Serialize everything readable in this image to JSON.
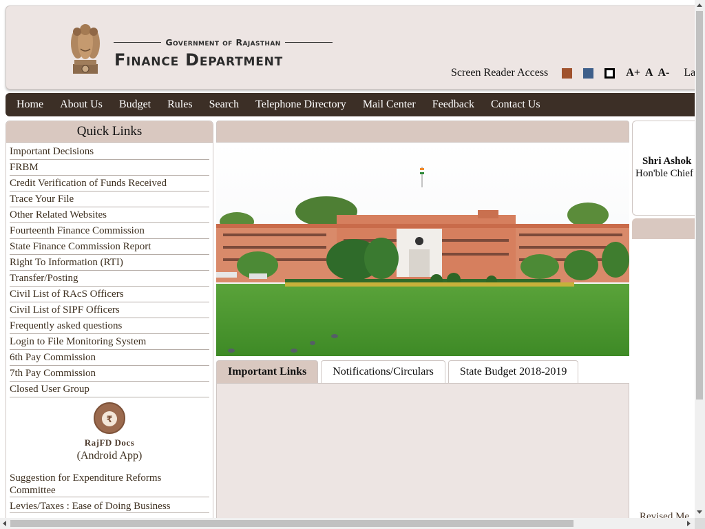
{
  "header": {
    "gov_line": "Government of Rajasthan",
    "dept_title": "Finance Department",
    "screen_reader": "Screen Reader Access",
    "font_increase": "A+",
    "font_normal": "A",
    "font_decrease": "A-",
    "language_partial": "La",
    "theme_colors": {
      "orange": "#a0522d",
      "blue": "#3e5f8a",
      "high_contrast": "#000000"
    }
  },
  "nav": {
    "items": [
      {
        "label": "Home"
      },
      {
        "label": "About Us"
      },
      {
        "label": "Budget"
      },
      {
        "label": "Rules"
      },
      {
        "label": "Search"
      },
      {
        "label": "Telephone Directory"
      },
      {
        "label": "Mail Center"
      },
      {
        "label": "Feedback"
      },
      {
        "label": "Contact Us"
      }
    ]
  },
  "sidebar": {
    "title": "Quick Links",
    "links": [
      {
        "label": "Important Decisions"
      },
      {
        "label": "FRBM"
      },
      {
        "label": "Credit Verification of Funds Received"
      },
      {
        "label": "Trace Your File"
      },
      {
        "label": "Other Related Websites"
      },
      {
        "label": "Fourteenth Finance Commission"
      },
      {
        "label": "State Finance Commission Report"
      },
      {
        "label": "Right To Information (RTI)"
      },
      {
        "label": "Transfer/Posting"
      },
      {
        "label": "Civil List of RAcS Officers"
      },
      {
        "label": "Civil List of SIPF Officers"
      },
      {
        "label": "Frequently asked questions"
      },
      {
        "label": "Login to File Monitoring System"
      },
      {
        "label": "6th Pay Commission"
      },
      {
        "label": "7th Pay Commission"
      },
      {
        "label": "Closed User Group"
      }
    ],
    "app": {
      "name": "RajFD Docs",
      "subtitle": "(Android App)",
      "icon_glyph": "₹"
    },
    "more_links": [
      {
        "label": "Suggestion for Expenditure Reforms Committee"
      },
      {
        "label": "Levies/Taxes : Ease of Doing Business"
      }
    ]
  },
  "main": {
    "tabs": [
      {
        "label": "Important Links",
        "active": true
      },
      {
        "label": "Notifications/Circulars",
        "active": false
      },
      {
        "label": "State Budget 2018-2019",
        "active": false
      }
    ]
  },
  "right": {
    "cm_name": "Shri Ashok",
    "cm_title": "Hon'ble Chief",
    "bottom_note": "Revised Me"
  }
}
